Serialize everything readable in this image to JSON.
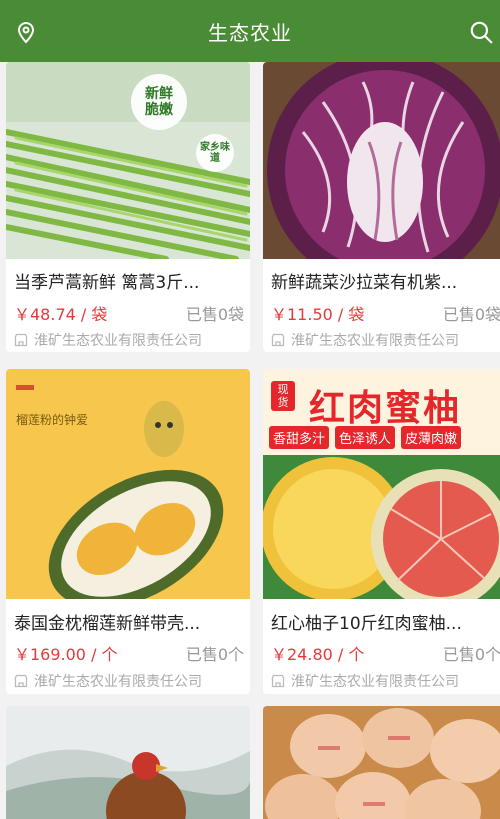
{
  "header": {
    "title": "生态农业",
    "left_icon": "location-pin-icon",
    "right_icon": "search-icon"
  },
  "products": [
    {
      "name": "当季芦蒿新鲜 篱蒿3斤...",
      "price": "￥48.74 / 袋",
      "sold": "已售0袋",
      "shop": "淮矿生态农业有限责任公司",
      "badge_line1": "新鲜",
      "badge_line2": "脆嫩",
      "badge2": "家乡味道"
    },
    {
      "name": "新鲜蔬菜沙拉菜有机紫...",
      "price": "￥11.50 / 袋",
      "sold": "已售0袋",
      "shop": "淮矿生态农业有限责任公司"
    },
    {
      "name": "泰国金枕榴莲新鲜带壳...",
      "price": "￥169.00 / 个",
      "sold": "已售0个",
      "shop": "淮矿生态农业有限责任公司",
      "img_text": "榴莲粉的钟爱"
    },
    {
      "name": "红心柚子10斤红肉蜜柚...",
      "price": "￥24.80 / 个",
      "sold": "已售0个",
      "shop": "淮矿生态农业有限责任公司",
      "banner": "红肉蜜柚",
      "tag": "现货",
      "chips": [
        "香甜多汁",
        "色泽诱人",
        "皮薄肉嫩"
      ]
    }
  ],
  "colors": {
    "brand": "#4a8b36",
    "price": "#e43a3a",
    "muted": "#999999"
  }
}
